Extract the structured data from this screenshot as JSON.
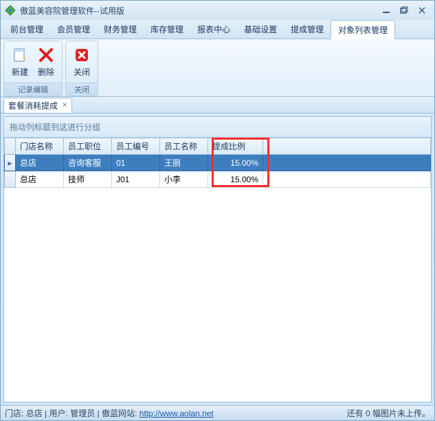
{
  "title": "傲蓝美容院管理软件--试用版",
  "menus": [
    "前台管理",
    "会员管理",
    "财务管理",
    "库存管理",
    "报表中心",
    "基础设置",
    "提成管理",
    "对象列表管理"
  ],
  "active_menu": 7,
  "ribbon": {
    "group1": {
      "label": "记录编辑",
      "new": "新建",
      "delete": "删除"
    },
    "group2": {
      "label": "关闭",
      "close": "关闭"
    }
  },
  "tab": {
    "label": "套餐消耗提成"
  },
  "group_hint": "拖动列标题到这进行分组",
  "columns": [
    "门店名称",
    "员工职位",
    "员工编号",
    "员工名称",
    "提成比例"
  ],
  "rows": [
    {
      "store": "总店",
      "position": "咨询客服",
      "code": "01",
      "name": "王丽",
      "ratio": "15.00%",
      "selected": true
    },
    {
      "store": "总店",
      "position": "技师",
      "code": "J01",
      "name": "小李",
      "ratio": "15.00%",
      "selected": false
    }
  ],
  "status": {
    "store_label": "门店:",
    "store": "总店",
    "user_label": "用户:",
    "user": "管理员",
    "site_label": "傲蓝网站:",
    "site": "http://www.aolan.net",
    "upload": "还有 0 幅图片未上传。"
  }
}
